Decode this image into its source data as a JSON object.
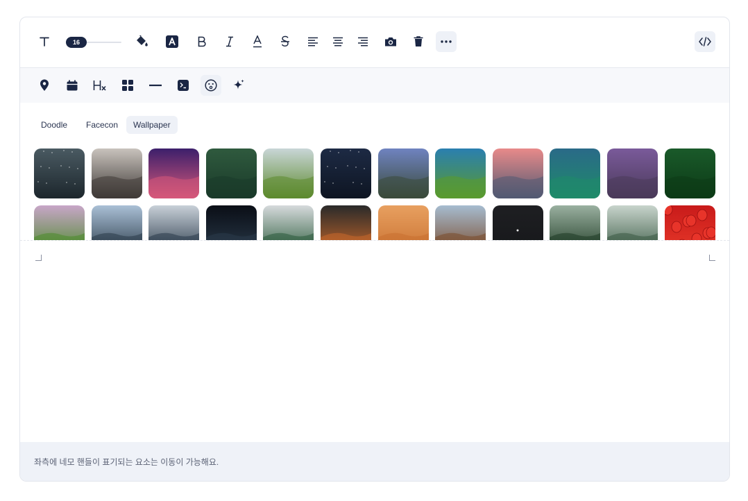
{
  "toolbar": {
    "font_size": "16",
    "buttons": [
      {
        "icon": "text-icon"
      },
      {
        "icon": "paint-bucket-icon"
      },
      {
        "icon": "text-highlight-icon"
      },
      {
        "icon": "bold-icon"
      },
      {
        "icon": "italic-icon"
      },
      {
        "icon": "underline-icon"
      },
      {
        "icon": "strikethrough-icon"
      },
      {
        "icon": "align-left-icon"
      },
      {
        "icon": "align-center-icon"
      },
      {
        "icon": "align-right-icon"
      },
      {
        "icon": "camera-icon"
      },
      {
        "icon": "trash-icon"
      },
      {
        "icon": "more-icon",
        "active": true
      },
      {
        "icon": "code-icon"
      }
    ]
  },
  "insert_toolbar": {
    "buttons": [
      {
        "icon": "map-pin-icon"
      },
      {
        "icon": "calendar-icon"
      },
      {
        "icon": "heading-icon"
      },
      {
        "icon": "grid-icon"
      },
      {
        "icon": "horizontal-rule-icon"
      },
      {
        "icon": "terminal-icon"
      },
      {
        "icon": "emoji-icon",
        "active": true
      },
      {
        "icon": "sparkle-icon"
      }
    ]
  },
  "panel": {
    "tabs": [
      {
        "label": "Doodle",
        "active": false
      },
      {
        "label": "Facecon",
        "active": false
      },
      {
        "label": "Wallpaper",
        "active": true
      }
    ],
    "wallpapers": [
      {
        "subject": "night-sky-stars",
        "colors": [
          "#4a5a62",
          "#1c262c"
        ]
      },
      {
        "subject": "desert-road",
        "colors": [
          "#c9c3bd",
          "#3f3a37"
        ]
      },
      {
        "subject": "purple-galaxy",
        "colors": [
          "#3c1f6b",
          "#d6587a"
        ]
      },
      {
        "subject": "forest-aerial-road",
        "colors": [
          "#2f5a3e",
          "#1a3a29"
        ]
      },
      {
        "subject": "green-hills",
        "colors": [
          "#c9d6d7",
          "#5d8a2e"
        ]
      },
      {
        "subject": "starry-lake",
        "colors": [
          "#1d2a44",
          "#0e1522"
        ]
      },
      {
        "subject": "mountain-lake",
        "colors": [
          "#6f83c0",
          "#3a4a3a"
        ]
      },
      {
        "subject": "grass-sunset",
        "colors": [
          "#2a7fb0",
          "#5a9a2e"
        ]
      },
      {
        "subject": "pink-mountains",
        "colors": [
          "#e88a8a",
          "#525a72"
        ]
      },
      {
        "subject": "teal-mountain-field",
        "colors": [
          "#2a6a88",
          "#1f8a6a"
        ]
      },
      {
        "subject": "purple-rocky-shore",
        "colors": [
          "#7a5a9a",
          "#4a3a5a"
        ]
      },
      {
        "subject": "green-foliage",
        "colors": [
          "#1a5a2a",
          "#0c3a16"
        ]
      },
      {
        "subject": "cliff-waterfall",
        "colors": [
          "#c8a6c8",
          "#4a8a2a"
        ]
      },
      {
        "subject": "seaside-town",
        "colors": [
          "#aac0d6",
          "#2a3a48"
        ]
      },
      {
        "subject": "city-aerial-dusk",
        "colors": [
          "#c8d0d8",
          "#2a3a4a"
        ]
      },
      {
        "subject": "earth-at-night",
        "colors": [
          "#0a0e16",
          "#2a3a4a"
        ]
      },
      {
        "subject": "misty-forest",
        "colors": [
          "#d6dadc",
          "#2a5a3a"
        ]
      },
      {
        "subject": "koi-fish",
        "colors": [
          "#2a2a2a",
          "#c8682a"
        ]
      },
      {
        "subject": "sunset-birds",
        "colors": [
          "#e8a060",
          "#c87030"
        ]
      },
      {
        "subject": "sea-rock",
        "colors": [
          "#a6bcd0",
          "#7a4a2a"
        ]
      },
      {
        "subject": "dark-moon",
        "colors": [
          "#1e1f22",
          "#16171a"
        ]
      },
      {
        "subject": "tall-trees",
        "colors": [
          "#9ab0a0",
          "#1e3a24"
        ]
      },
      {
        "subject": "foggy-valley",
        "colors": [
          "#c8d4cc",
          "#3a5a44"
        ]
      },
      {
        "subject": "strawberries",
        "colors": [
          "#c81a1a",
          "#e83a2a"
        ]
      }
    ]
  },
  "footer": {
    "text": "좌측에 네모 핸들이 표기되는 요소는 이동이 가능해요."
  }
}
